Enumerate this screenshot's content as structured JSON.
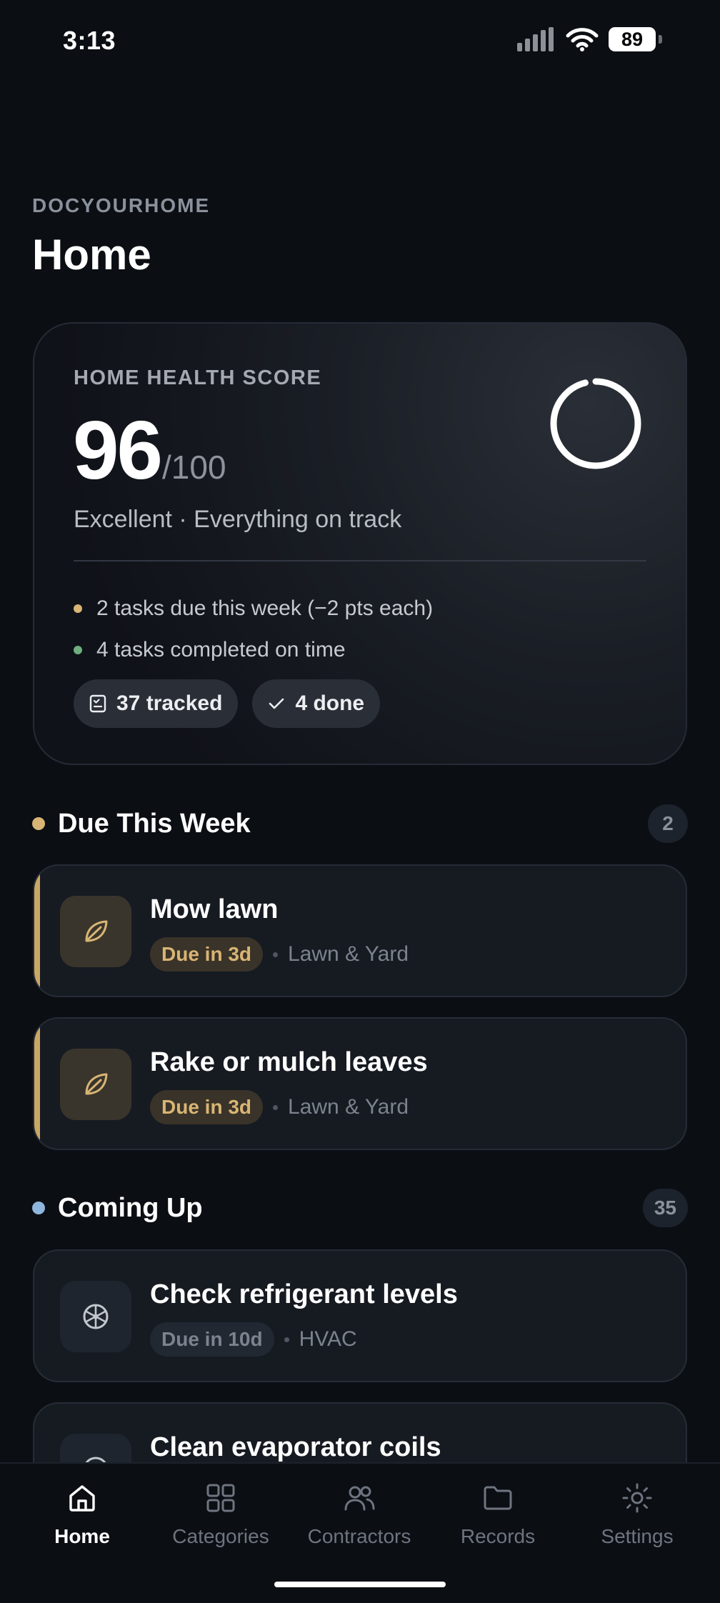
{
  "status_bar": {
    "time": "3:13",
    "battery": "89"
  },
  "header": {
    "brand": "DOCYOURHOME",
    "title": "Home"
  },
  "health": {
    "label": "HOME HEALTH SCORE",
    "score": "96",
    "max": "/100",
    "status": "Excellent · Everything on track",
    "score_fraction": 0.96,
    "bullets": [
      {
        "text": "2 tasks due this week (−2 pts each)",
        "color": "#d8b574"
      },
      {
        "text": "4 tasks completed on time",
        "color": "#6fae7e"
      }
    ],
    "chips": {
      "tracked": "37 tracked",
      "done": "4 done"
    }
  },
  "due_this_week": {
    "title": "Due This Week",
    "count": "2",
    "dot_color": "#d8b574",
    "tasks": [
      {
        "title": "Mow lawn",
        "due": "Due in 3d",
        "category": "Lawn & Yard",
        "icon": "leaf-icon"
      },
      {
        "title": "Rake or mulch leaves",
        "due": "Due in 3d",
        "category": "Lawn & Yard",
        "icon": "leaf-icon"
      }
    ]
  },
  "coming_up": {
    "title": "Coming Up",
    "count": "35",
    "dot_color": "#8fb6de",
    "tasks": [
      {
        "title": "Check refrigerant levels",
        "due": "Due in 10d",
        "category": "HVAC",
        "icon": "fan-icon"
      },
      {
        "title": "Clean evaporator coils",
        "icon": "fan-icon"
      }
    ]
  },
  "nav": {
    "items": [
      {
        "label": "Home",
        "icon": "home-icon"
      },
      {
        "label": "Categories",
        "icon": "grid-icon"
      },
      {
        "label": "Contractors",
        "icon": "people-icon"
      },
      {
        "label": "Records",
        "icon": "folder-icon"
      },
      {
        "label": "Settings",
        "icon": "sun-icon"
      }
    ],
    "active": "Home"
  }
}
